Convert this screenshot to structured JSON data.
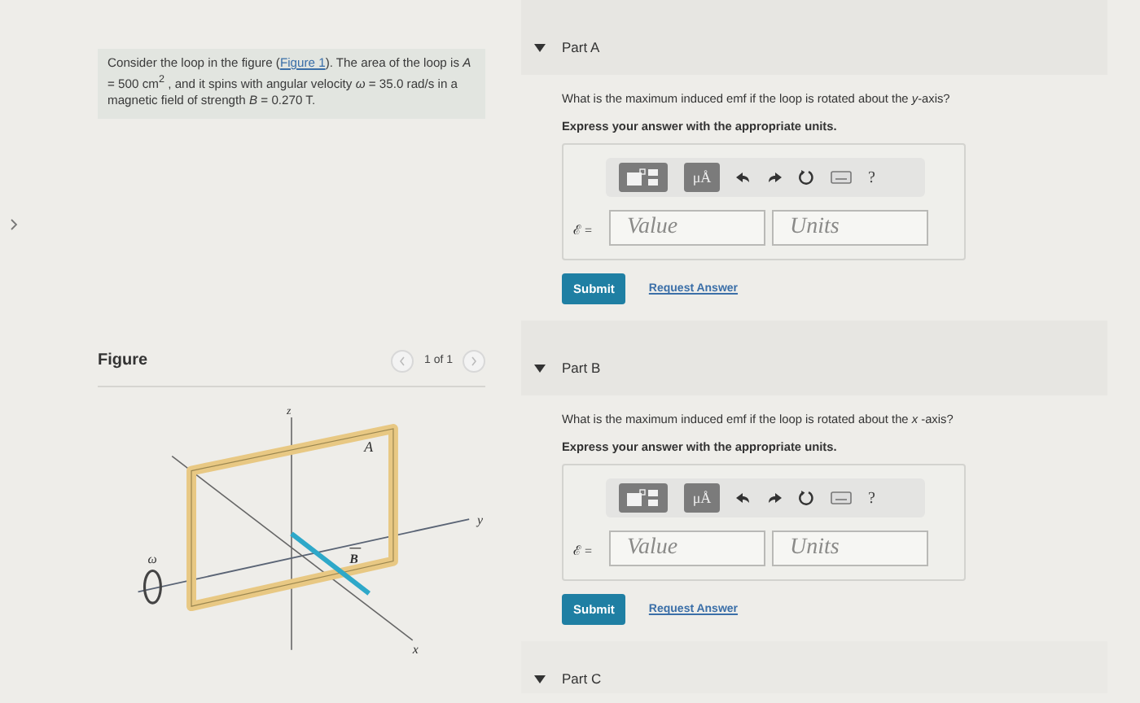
{
  "problem": {
    "before_link": "Consider the loop in the figure (",
    "link": "Figure 1",
    "after_link": "). The area of the loop is *A* = 500 cm$^{2}$ , and it spins with angular velocity *ω* = 35.0 rad/s in a magnetic field of strength *B* = 0.270 T."
  },
  "figure": {
    "title": "Figure",
    "pager": "1 of 1",
    "labels": {
      "z": "z",
      "y": "y",
      "x": "x",
      "area": "A",
      "field": "B",
      "omega": "ω"
    }
  },
  "parts": [
    {
      "title": "Part A",
      "expanded": true,
      "question": "What is the maximum induced emf if the loop is rotated about the *y*-axis?",
      "instruction": "Express your answer with the appropriate units.",
      "toolbar": {
        "units": "μÅ",
        "help": "?"
      },
      "symbol": "ℰ =",
      "value_placeholder": "Value",
      "units_placeholder": "Units",
      "submit": "Submit",
      "request": "Request Answer"
    },
    {
      "title": "Part B",
      "expanded": true,
      "question": "What is the maximum induced emf if the loop is rotated about the *x* -axis?",
      "instruction": "Express your answer with the appropriate units.",
      "toolbar": {
        "units": "μÅ",
        "help": "?"
      },
      "symbol": "ℰ =",
      "value_placeholder": "Value",
      "units_placeholder": "Units",
      "submit": "Submit",
      "request": "Request Answer"
    },
    {
      "title": "Part C",
      "expanded": true
    }
  ]
}
